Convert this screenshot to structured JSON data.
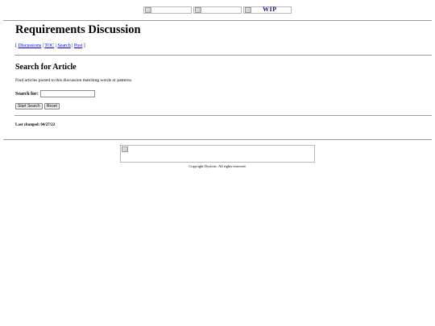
{
  "nav": {
    "wip_label": "WIP"
  },
  "page": {
    "title": "Requirements Discussion",
    "links": {
      "open": "[ ",
      "discussions": "Discussions",
      "sep1": " | ",
      "toc": "TOC",
      "sep2": " | ",
      "search": "Search",
      "sep3": " | ",
      "post": "Post",
      "close": " ]"
    }
  },
  "search_section": {
    "heading": "Search for Article",
    "description": "Find articles posted to this discussion matching words or patterns.",
    "search_label": "Search for:",
    "search_value": "",
    "start_button": "Start Search",
    "reset_button": "Reset"
  },
  "last_changed": "Last changed: 04/27/22",
  "footer": {
    "copyright": "Copyright Dysfrsic. All rights reserved."
  }
}
